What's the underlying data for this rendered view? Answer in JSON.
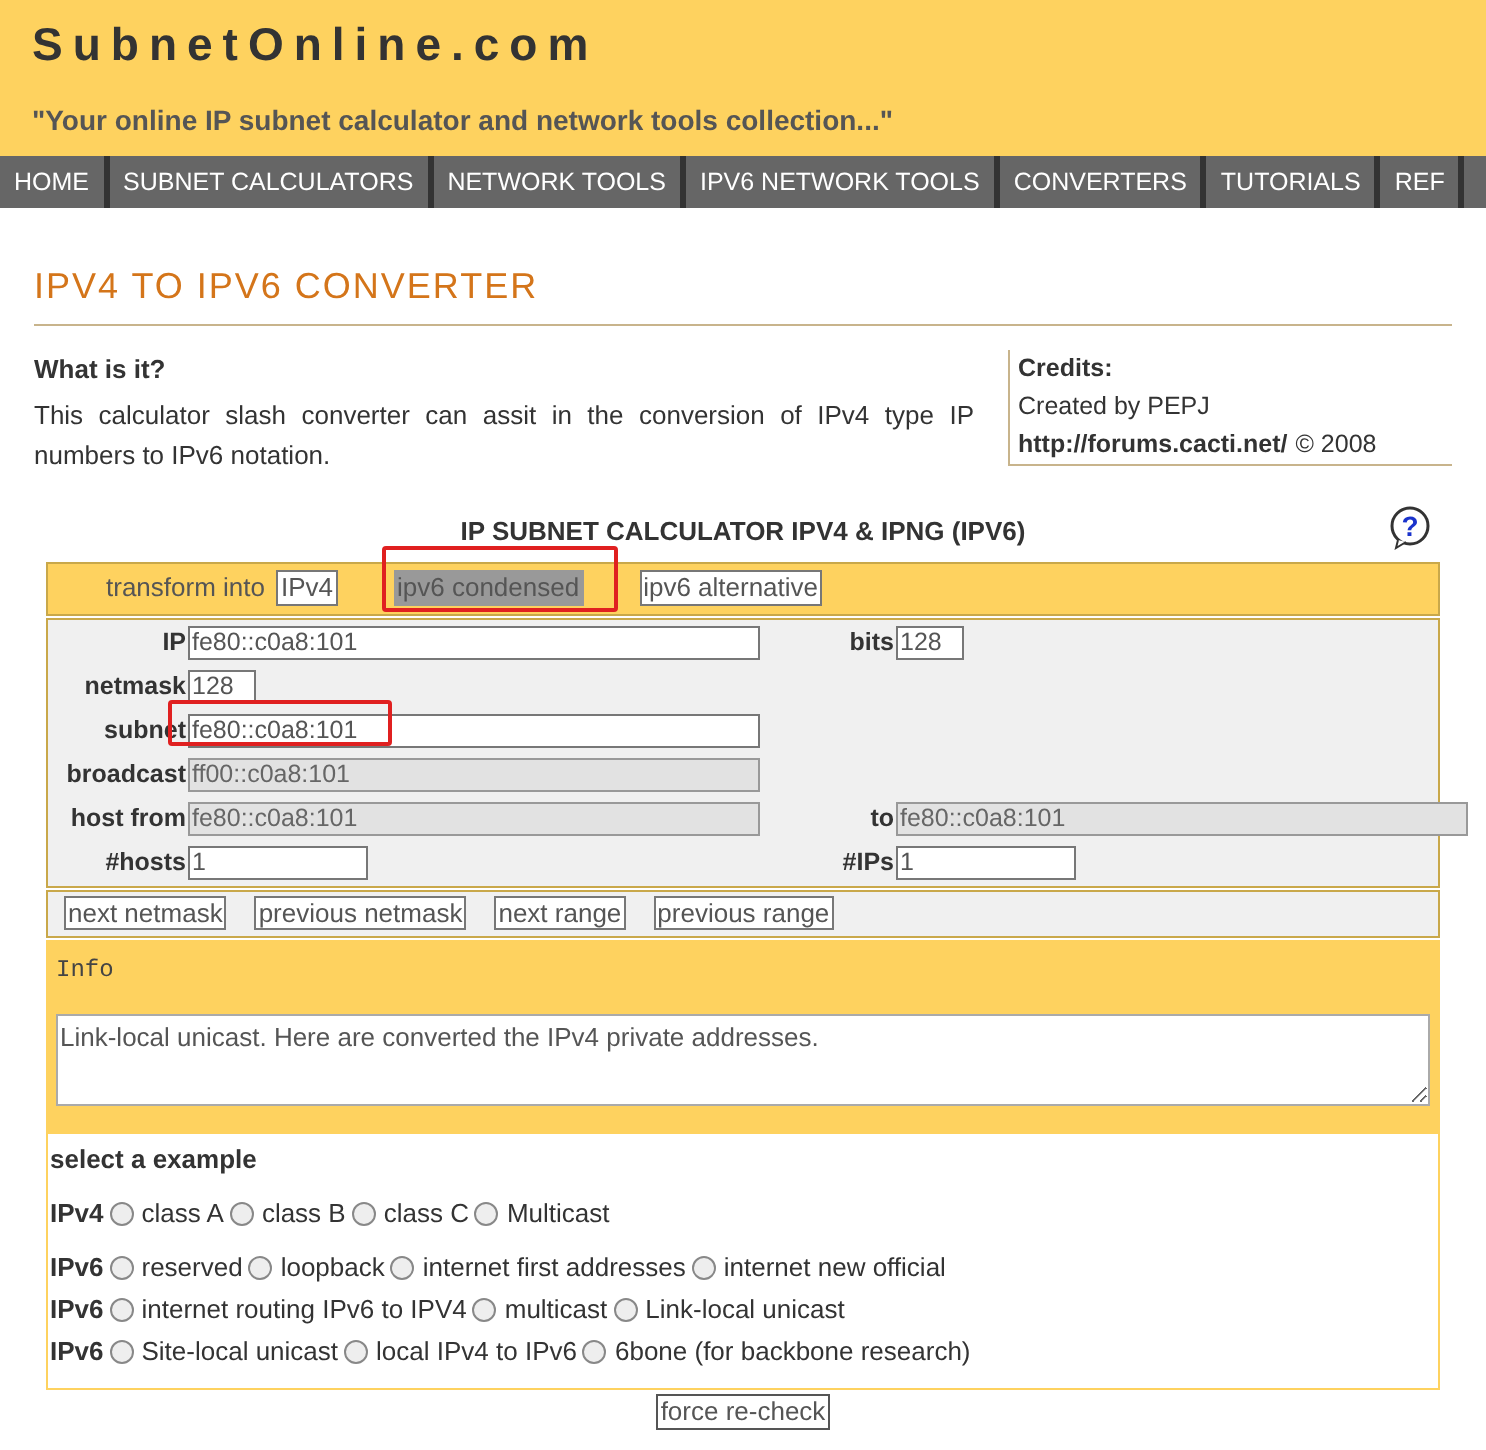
{
  "header": {
    "title": "SubnetOnline.com",
    "tagline": "\"Your online IP subnet calculator and network tools collection...\""
  },
  "nav": [
    {
      "label": "HOME"
    },
    {
      "label": "SUBNET CALCULATORS"
    },
    {
      "label": "NETWORK TOOLS"
    },
    {
      "label": "IPV6 NETWORK TOOLS"
    },
    {
      "label": "CONVERTERS"
    },
    {
      "label": "TUTORIALS"
    },
    {
      "label": "REF"
    }
  ],
  "page_title": "IPV4 TO IPV6 CONVERTER",
  "about": {
    "heading": "What is it?",
    "text": "This calculator slash converter can assit in the conversion of IPv4 type IP numbers to IPv6 notation."
  },
  "credits": {
    "heading": "Credits:",
    "created": "Created by PEPJ",
    "link": "http://forums.cacti.net/",
    "year": "© 2008"
  },
  "calculator": {
    "title": "IP SUBNET CALCULATOR IPV4 & IPNG (IPV6)",
    "help": "?",
    "transform": {
      "label": "transform into",
      "options": [
        {
          "label": "IPv4",
          "selected": false,
          "highlighted": false
        },
        {
          "label": "ipv6 condensed",
          "selected": true,
          "highlighted": true
        },
        {
          "label": "ipv6 alternative",
          "selected": false,
          "highlighted": false
        }
      ]
    },
    "rows": [
      {
        "left": {
          "label": "IP",
          "value": "fe80::c0a8:101",
          "readonly": false,
          "highlighted": false
        },
        "right": {
          "label": "bits",
          "value": "128",
          "readonly": false,
          "highlighted": false
        }
      },
      {
        "left": {
          "label": "netmask",
          "value": "128",
          "readonly": false,
          "highlighted": false
        }
      },
      {
        "left": {
          "label": "subnet",
          "value": "fe80::c0a8:101",
          "readonly": false,
          "highlighted": true
        }
      },
      {
        "left": {
          "label": "broadcast",
          "value": "ff00::c0a8:101",
          "readonly": true,
          "highlighted": false
        }
      },
      {
        "left": {
          "label": "host from",
          "value": "fe80::c0a8:101",
          "readonly": true,
          "highlighted": false
        },
        "right": {
          "label": "to",
          "value": "fe80::c0a8:101",
          "readonly": true,
          "highlighted": false
        }
      },
      {
        "left": {
          "label": "#hosts",
          "value": "1",
          "readonly": false,
          "highlighted": false
        },
        "right": {
          "label": "#IPs",
          "value": "1",
          "readonly": false,
          "highlighted": false
        }
      }
    ],
    "buttons": [
      "next netmask",
      "previous netmask",
      "next range",
      "previous range"
    ],
    "info": {
      "label": "Info",
      "text": "Link-local unicast. Here are converted the IPv4 private addresses."
    },
    "examples": {
      "heading": "select a example",
      "groups": [
        {
          "label": "IPv4",
          "options": [
            {
              "label": "class A",
              "selected": false
            },
            {
              "label": "class B",
              "selected": false
            },
            {
              "label": "class C",
              "selected": false
            },
            {
              "label": "Multicast",
              "selected": false
            }
          ]
        },
        {
          "label": "IPv6",
          "options": [
            {
              "label": "reserved",
              "selected": false
            },
            {
              "label": "loopback",
              "selected": false
            },
            {
              "label": "internet first addresses",
              "selected": false
            },
            {
              "label": "internet new official",
              "selected": false
            }
          ]
        },
        {
          "label": "IPv6",
          "options": [
            {
              "label": "internet routing IPv6 to IPV4",
              "selected": false
            },
            {
              "label": "multicast",
              "selected": false
            },
            {
              "label": "Link-local unicast",
              "selected": false
            }
          ]
        },
        {
          "label": "IPv6",
          "options": [
            {
              "label": "Site-local unicast",
              "selected": false
            },
            {
              "label": "local IPv4 to IPv6",
              "selected": false
            },
            {
              "label": "6bone (for backbone research)",
              "selected": false
            }
          ]
        }
      ]
    },
    "force_button": "force re-check"
  }
}
